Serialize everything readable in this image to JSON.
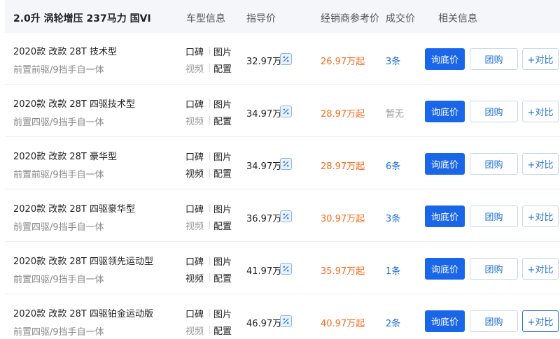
{
  "header": {
    "title": "2.0升 涡轮增压 237马力 国VI",
    "columns": {
      "info": "车型信息",
      "guide": "指导价",
      "dealer": "经销商参考价",
      "deal": "成交价",
      "related": "相关信息"
    }
  },
  "links": {
    "koubei": "口碑",
    "pic": "图片",
    "video": "视频",
    "config": "配置"
  },
  "buttons": {
    "ask": "询底价",
    "group": "团购",
    "compare": "+对比"
  },
  "colors": {
    "accent": "#1a66e8",
    "price_orange": "#ff6a1a",
    "link_blue": "#1f6fd8"
  },
  "rows": [
    {
      "name": "2020款 改款 28T 技术型",
      "spec": "前置前驱/9挡手自一体",
      "guide": "32.97万",
      "dealer": "26.97万起",
      "deal": "3条"
    },
    {
      "name": "2020款 改款 28T 四驱技术型",
      "spec": "前置四驱/9挡手自一体",
      "guide": "34.97万",
      "dealer": "28.97万起",
      "deal": "暂无"
    },
    {
      "name": "2020款 改款 28T 豪华型",
      "spec": "前置前驱/9挡手自一体",
      "guide": "34.97万",
      "dealer": "28.97万起",
      "deal": "6条"
    },
    {
      "name": "2020款 改款 28T 四驱豪华型",
      "spec": "前置四驱/9挡手自一体",
      "guide": "36.97万",
      "dealer": "30.97万起",
      "deal": "3条"
    },
    {
      "name": "2020款 改款 28T 四驱领先运动型",
      "spec": "前置四驱/9挡手自一体",
      "guide": "41.97万",
      "dealer": "35.97万起",
      "deal": "1条"
    },
    {
      "name": "2020款 改款 28T 四驱铂金运动版",
      "spec": "前置四驱/9挡手自一体",
      "guide": "46.97万",
      "dealer": "40.97万起",
      "deal": "2条"
    }
  ]
}
